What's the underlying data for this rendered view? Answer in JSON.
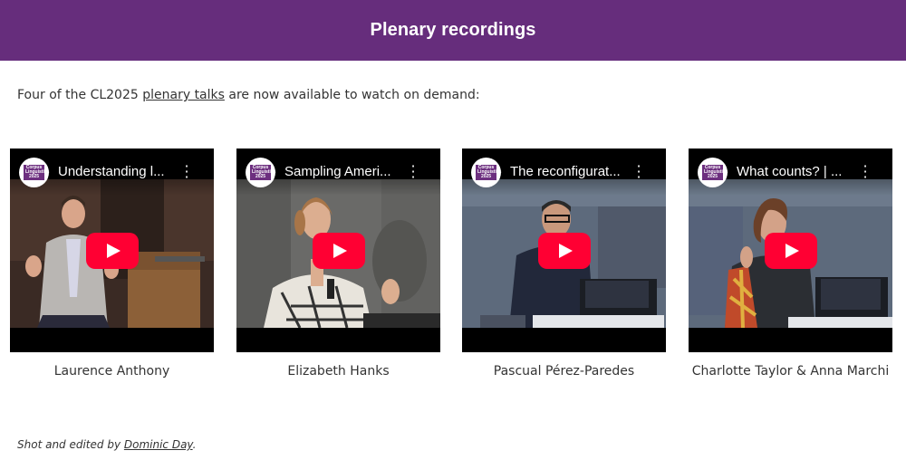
{
  "header": {
    "title": "Plenary recordings"
  },
  "intro": {
    "before": "Four of the CL2025 ",
    "link": "plenary talks",
    "after": " are now available to watch on demand:"
  },
  "channel_logo_text": "Corpus Linguistics 2025",
  "videos": [
    {
      "title": "Understanding l...",
      "speaker": "Laurence Anthony"
    },
    {
      "title": "Sampling Ameri...",
      "speaker": "Elizabeth Hanks"
    },
    {
      "title": "The reconfigurat...",
      "speaker": "Pascual Pérez-Paredes"
    },
    {
      "title": "What counts? | ...",
      "speaker": "Charlotte Taylor & Anna Marchi"
    }
  ],
  "credit": {
    "before": "Shot and edited by ",
    "link": "Dominic Day",
    "after": "."
  },
  "colors": {
    "banner": "#662d7c",
    "play_button": "#ff0033",
    "text": "#333333"
  },
  "icons": [
    "play-icon",
    "more-vertical-icon",
    "channel-logo-icon"
  ]
}
